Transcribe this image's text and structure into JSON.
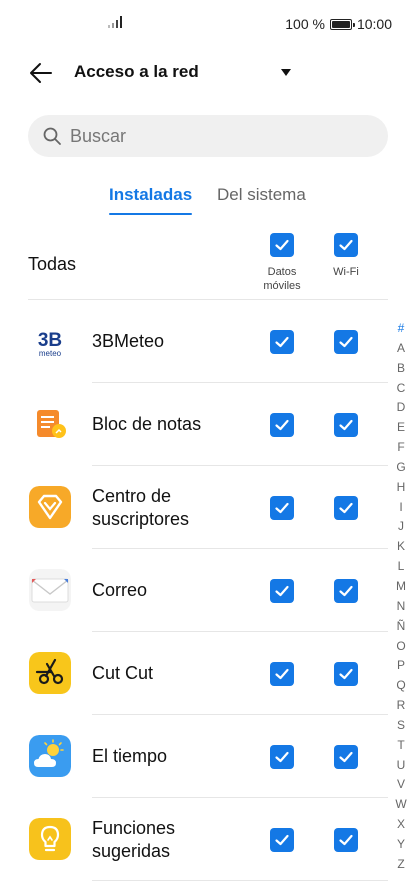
{
  "status_bar": {
    "battery": "100 %",
    "time": "10:00"
  },
  "header": {
    "title": "Acceso a la red"
  },
  "search": {
    "placeholder": "Buscar"
  },
  "tabs": [
    {
      "label": "Instaladas",
      "active": true
    },
    {
      "label": "Del sistema",
      "active": false
    }
  ],
  "all_row": {
    "label": "Todas",
    "col_datos": "Datos móviles",
    "col_wifi": "Wi-Fi",
    "datos_checked": true,
    "wifi_checked": true
  },
  "apps": [
    {
      "name": "3BMeteo",
      "icon": "3bmeteo-icon",
      "datos": true,
      "wifi": true
    },
    {
      "name": "Bloc de notas",
      "icon": "notepad-icon",
      "datos": true,
      "wifi": true
    },
    {
      "name": "Centro de suscriptores",
      "icon": "diamond-icon",
      "datos": true,
      "wifi": true
    },
    {
      "name": "Correo",
      "icon": "mail-icon",
      "datos": true,
      "wifi": true
    },
    {
      "name": "Cut Cut",
      "icon": "scissors-icon",
      "datos": true,
      "wifi": true
    },
    {
      "name": "El tiempo",
      "icon": "weather-icon",
      "datos": true,
      "wifi": true
    },
    {
      "name": "Funciones sugeridas",
      "icon": "lightbulb-icon",
      "datos": true,
      "wifi": true
    }
  ],
  "index_letters": [
    "#",
    "A",
    "B",
    "C",
    "D",
    "E",
    "F",
    "G",
    "H",
    "I",
    "J",
    "K",
    "L",
    "M",
    "N",
    "Ñ",
    "O",
    "P",
    "Q",
    "R",
    "S",
    "T",
    "U",
    "V",
    "W",
    "X",
    "Y",
    "Z"
  ],
  "colors": {
    "accent": "#1478e5",
    "text": "#111111",
    "search_bg": "#f0f0f0"
  }
}
